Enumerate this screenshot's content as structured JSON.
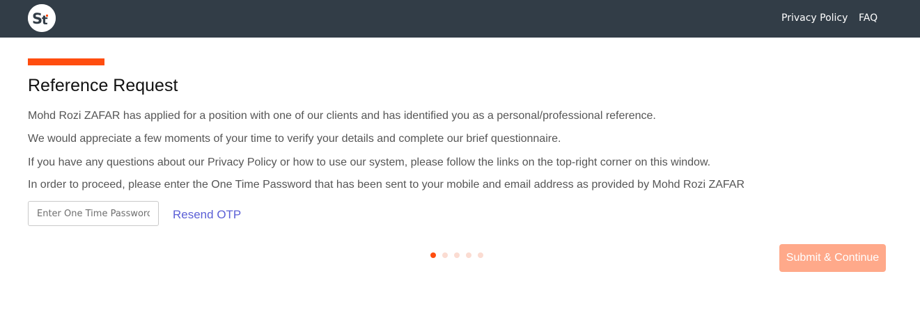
{
  "header": {
    "logo_icon": "st-logo-icon",
    "links": {
      "privacy": "Privacy Policy",
      "faq": "FAQ"
    }
  },
  "main": {
    "title": "Reference Request",
    "paragraphs": [
      "Mohd Rozi ZAFAR has applied for a position with one of our clients and has identified you as a personal/professional reference.",
      "We would appreciate a few moments of your time to verify your details and complete our brief questionnaire.",
      "If you have any questions about our Privacy Policy or how to use our system, please follow the links on the top-right corner on this window.",
      "In order to proceed, please enter the One Time Password that has been sent to your mobile and email address as provided by Mohd Rozi ZAFAR"
    ],
    "otp": {
      "placeholder": "Enter One Time Password",
      "value": ""
    },
    "resend_label": "Resend OTP",
    "progress": {
      "total_steps": 5,
      "current_step": 1
    },
    "submit_label": "Submit & Continue"
  },
  "colors": {
    "header_bg": "#323d47",
    "accent": "#ff4d0f",
    "link": "#5b5fd6",
    "submit_disabled": "#ffa98a"
  }
}
